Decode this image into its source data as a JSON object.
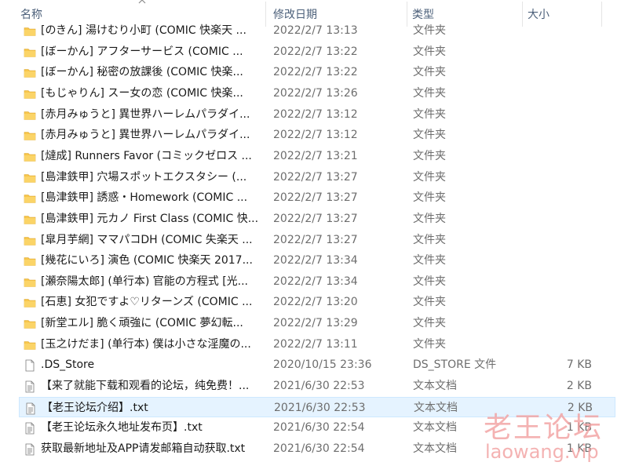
{
  "columns": {
    "name": "名称",
    "date": "修改日期",
    "type": "类型",
    "size": "大小"
  },
  "rows": [
    {
      "name": "[のきん] 湯けむり小町 (COMIC 快楽天 ...",
      "date": "2022/2/7 13:13",
      "type": "文件夹",
      "size": "",
      "icon": "folder-icon"
    },
    {
      "name": "[ぼーかん] アフターサービス (COMIC ...",
      "date": "2022/2/7 13:22",
      "type": "文件夹",
      "size": "",
      "icon": "folder-icon"
    },
    {
      "name": "[ぼーかん] 秘密の放課後 (COMIC 快楽...",
      "date": "2022/2/7 13:22",
      "type": "文件夹",
      "size": "",
      "icon": "folder-icon"
    },
    {
      "name": "[もじゃりん] スー女の恋 (COMIC 快楽...",
      "date": "2022/2/7 13:26",
      "type": "文件夹",
      "size": "",
      "icon": "folder-icon"
    },
    {
      "name": "[赤月みゅうと] 異世界ハーレムパラダイ...",
      "date": "2022/2/7 13:12",
      "type": "文件夹",
      "size": "",
      "icon": "folder-icon"
    },
    {
      "name": "[赤月みゅうと] 異世界ハーレムパラダイ...",
      "date": "2022/2/7 13:12",
      "type": "文件夹",
      "size": "",
      "icon": "folder-icon"
    },
    {
      "name": "[燵成] Runners Favor (コミックゼロス ...",
      "date": "2022/2/7 13:21",
      "type": "文件夹",
      "size": "",
      "icon": "folder-icon"
    },
    {
      "name": "[島津鉄甲] 穴場スポットエクスタシー (...",
      "date": "2022/2/7 13:27",
      "type": "文件夹",
      "size": "",
      "icon": "folder-icon"
    },
    {
      "name": "[島津鉄甲] 誘惑・Homework (COMIC ...",
      "date": "2022/2/7 13:27",
      "type": "文件夹",
      "size": "",
      "icon": "folder-icon"
    },
    {
      "name": "[島津鉄甲] 元カノ First Class (COMIC 快...",
      "date": "2022/2/7 13:27",
      "type": "文件夹",
      "size": "",
      "icon": "folder-icon"
    },
    {
      "name": "[皐月芋網] ママパコDH (COMIC 失楽天 ...",
      "date": "2022/2/7 13:27",
      "type": "文件夹",
      "size": "",
      "icon": "folder-icon"
    },
    {
      "name": "[幾花にいろ] 演色 (COMIC 快楽天 2017...",
      "date": "2022/2/7 13:34",
      "type": "文件夹",
      "size": "",
      "icon": "folder-icon"
    },
    {
      "name": "[瀬奈陽太郎] (单行本) 官能の方程式 [光...",
      "date": "2022/2/7 13:34",
      "type": "文件夹",
      "size": "",
      "icon": "folder-icon"
    },
    {
      "name": "[石恵] 女犯ですよ♡リターンズ (COMIC ...",
      "date": "2022/2/7 13:20",
      "type": "文件夹",
      "size": "",
      "icon": "folder-icon"
    },
    {
      "name": "[新堂エル] 脆く頑強に (COMIC 夢幻転...",
      "date": "2022/2/7 13:29",
      "type": "文件夹",
      "size": "",
      "icon": "folder-icon"
    },
    {
      "name": "[玉之けだま] (单行本) 僕は小さな淫魔の...",
      "date": "2022/2/7 13:11",
      "type": "文件夹",
      "size": "",
      "icon": "folder-icon"
    },
    {
      "name": ".DS_Store",
      "date": "2020/10/15 23:36",
      "type": "DS_STORE 文件",
      "size": "7 KB",
      "icon": "blank-file-icon"
    },
    {
      "name": "【来了就能下载和观看的论坛，纯免费！...",
      "date": "2021/6/30 22:53",
      "type": "文本文档",
      "size": "2 KB",
      "icon": "text-file-icon"
    },
    {
      "name": "【老王论坛介绍】.txt",
      "date": "2021/6/30 22:53",
      "type": "文本文档",
      "size": "2 KB",
      "icon": "text-file-icon",
      "selected": true
    },
    {
      "name": "【老王论坛永久地址发布页】.txt",
      "date": "2021/6/30 22:54",
      "type": "文本文档",
      "size": "1 KB",
      "icon": "text-file-icon"
    },
    {
      "name": "获取最新地址及APP请发邮箱自动获取.txt",
      "date": "2021/6/30 22:54",
      "type": "文本文档",
      "size": "1 KB",
      "icon": "text-file-icon"
    }
  ],
  "watermark": {
    "cn": "老王论坛",
    "en": "laowang.vip"
  },
  "colors": {
    "folder": "#f8c64b",
    "selection": "#e5f3ff",
    "header_text": "#4c607a",
    "watermark": "#f2a0a0"
  }
}
